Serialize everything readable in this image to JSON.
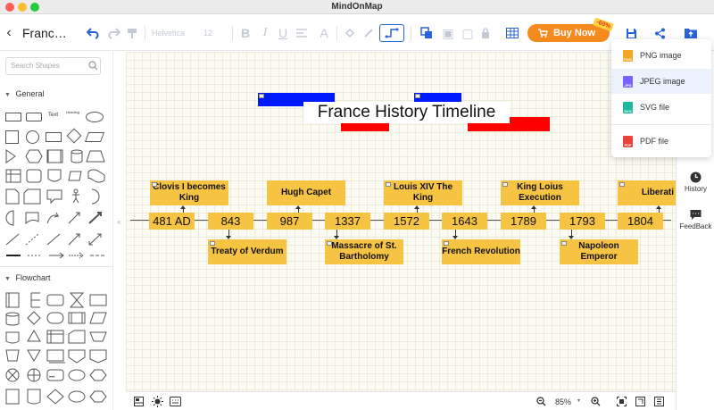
{
  "app": {
    "title": "MindOnMap",
    "doc_title": "Franc…"
  },
  "toolbar": {
    "font_family": "Helvetica",
    "font_size": "12",
    "buy_label": "Buy Now",
    "discount_badge": "-60%"
  },
  "left_panel": {
    "search_placeholder": "Search Shapes",
    "sections": [
      {
        "label": "General"
      },
      {
        "label": "Flowchart"
      }
    ],
    "text_shape_label": "Text",
    "heading_shape_label": "Heading"
  },
  "export_menu": {
    "items": [
      {
        "label": "PNG image",
        "icon": "png-file-icon",
        "color": "#f5a623"
      },
      {
        "label": "JPEG image",
        "icon": "jpeg-file-icon",
        "color": "#7b61ff",
        "active": true
      },
      {
        "label": "SVG file",
        "icon": "svg-file-icon",
        "color": "#1fb89a"
      },
      {
        "label": "PDF file",
        "icon": "pdf-file-icon",
        "color": "#e8433a"
      }
    ]
  },
  "right_rail": {
    "history_label": "History",
    "feedback_label": "FeedBack"
  },
  "canvas": {
    "title": "France History Timeline",
    "box_color": "#f6c342",
    "above_events": [
      "Clovis I becomes King",
      "Hugh Capet",
      "Louis XIV The King",
      "King Loius Execution",
      "Liberati"
    ],
    "below_events": [
      "Treaty of Verdum",
      "Massacre of St. Bartholomy",
      "French Revolution",
      "Napoleon Emperor"
    ],
    "years": [
      "481 AD",
      "843",
      "987",
      "1337",
      "1572",
      "1643",
      "1789",
      "1793",
      "1804"
    ]
  },
  "bottom_bar": {
    "zoom": "85%"
  },
  "colors": {
    "accent": "#2b63d9",
    "buy": "#f58a1f",
    "decor_blue": "#0019ff",
    "decor_red": "#ff0000"
  }
}
